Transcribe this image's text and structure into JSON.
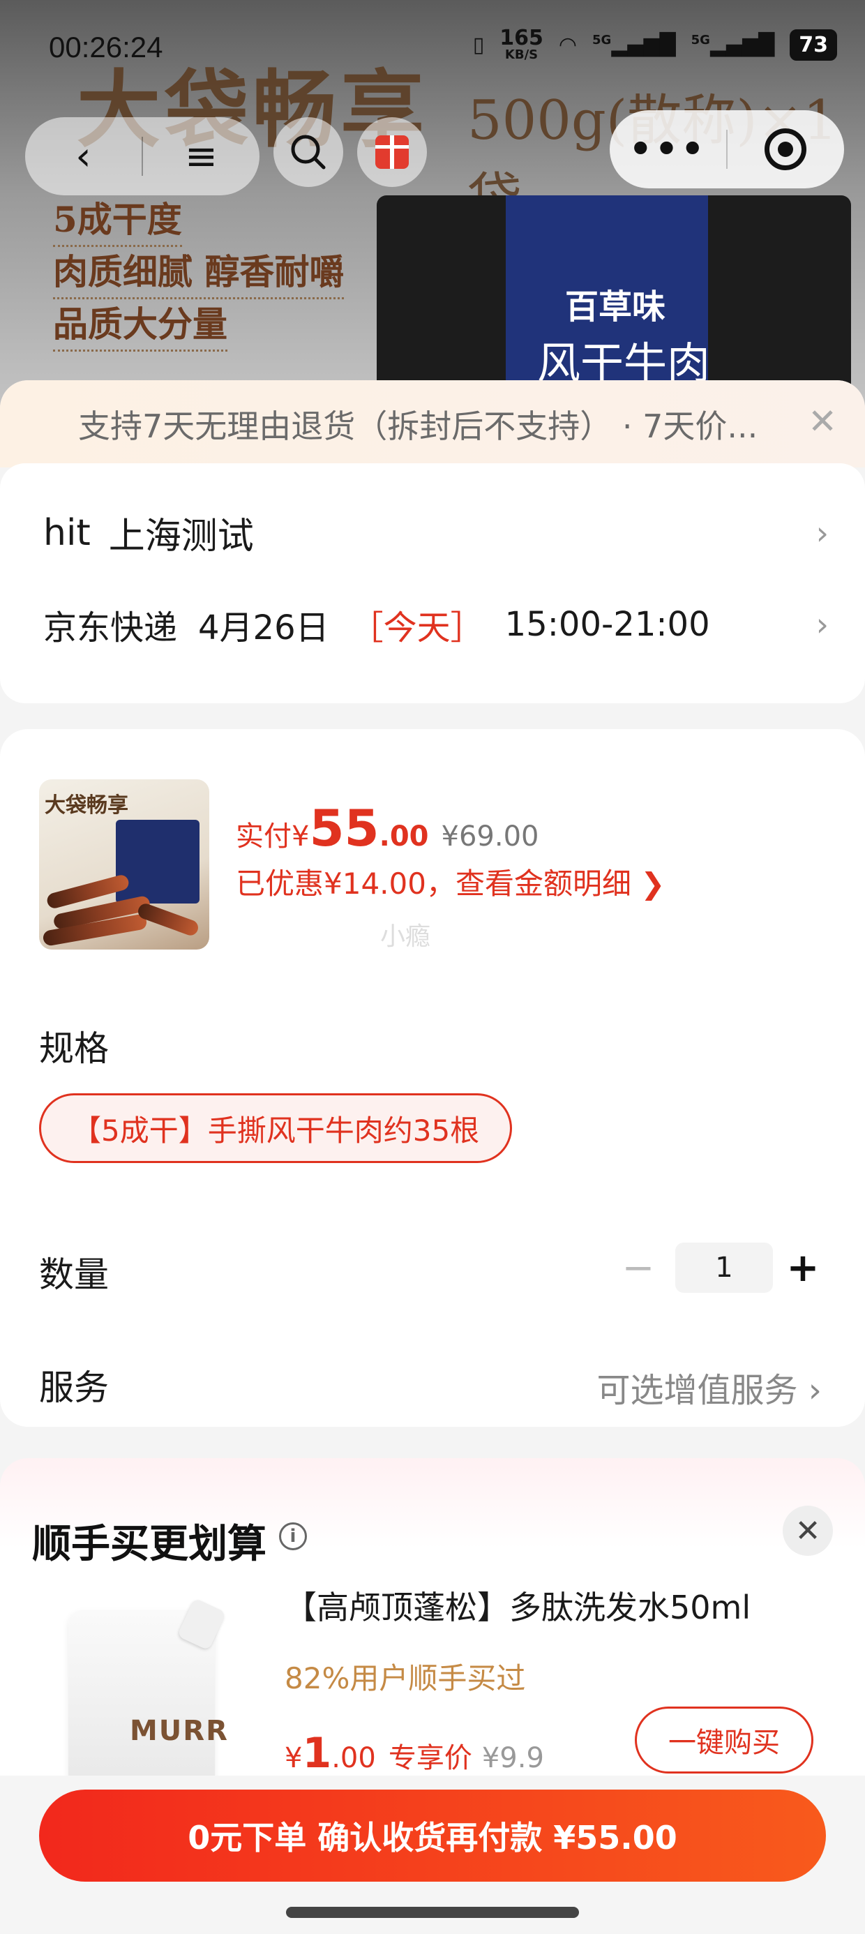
{
  "status_bar": {
    "time": "00:26:24",
    "net_speed_value": "165",
    "net_speed_unit": "KB/S",
    "signal_1": "5G",
    "signal_2": "5G",
    "battery": "73"
  },
  "hero": {
    "banner_title": "大袋畅享",
    "banner_weight": "500g(散称)×1袋",
    "features": [
      "5成干度",
      "肉质细腻 醇香耐嚼",
      "品质大分量"
    ],
    "pack_brand": "百草味",
    "pack_name": "风干牛肉"
  },
  "notice": {
    "text": "支持7天无理由退货（拆封后不支持） · 7天价...",
    "close_glyph": "✕"
  },
  "address": {
    "name": "hit",
    "location": "上海测试",
    "courier": "京东快递",
    "date": "4月26日",
    "today_tag": "［今天］",
    "time_window": "15:00-21:00"
  },
  "order": {
    "thumb_title": "大袋畅享",
    "price_label": "实付¥",
    "price_int": "55",
    "price_dec": ".00",
    "original_price": "¥69.00",
    "discount_text": "已优惠¥14.00，查看金额明细 ❯",
    "watermark": "小瘾",
    "spec_label": "规格",
    "spec_value": "【5成干】手撕风干牛肉约35根",
    "qty_label": "数量",
    "qty_minus": "−",
    "qty_value": "1",
    "qty_plus": "+",
    "service_label": "服务",
    "service_value": "可选增值服务 ›"
  },
  "upsell": {
    "title": "顺手买更划算",
    "info_glyph": "i",
    "close_glyph": "✕",
    "product_brand": "MURR",
    "product_name": "【高颅顶蓬松】多肽洗发水50ml",
    "stat": "82%用户顺手买过",
    "price_currency": "¥",
    "price_int": "1",
    "price_dec": ".00",
    "price_tag": "专享价",
    "original_price": "¥9.9",
    "buy_label": "一键购买"
  },
  "bottom": {
    "submit_label": "0元下单 确认收货再付款 ¥55.00"
  },
  "colors": {
    "accent": "#e0321f",
    "submit_start": "#f2281c",
    "submit_end": "#f85a1c"
  }
}
